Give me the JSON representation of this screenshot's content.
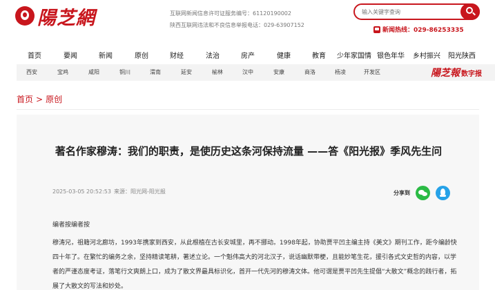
{
  "header": {
    "logo_text": "陽芝網",
    "license_line1": "互联网新闻信息许可证服务编号：61120190002",
    "license_line2": "陕西互联网违法和不良信息举报电话：029-63907152",
    "search_placeholder": "输入关键字查询",
    "hotline": "新闻热线：029-86253335"
  },
  "nav": {
    "items": [
      "首页",
      "要闻",
      "新闻",
      "原创",
      "财经",
      "法治",
      "房产",
      "健康",
      "教育",
      "少年家国情",
      "银色年华",
      "乡村振兴",
      "阳光陕西"
    ]
  },
  "subnav": {
    "items": [
      "西安",
      "宝鸡",
      "咸阳",
      "铜川",
      "渭南",
      "延安",
      "榆林",
      "汉中",
      "安康",
      "商洛",
      "杨凌",
      "开发区"
    ],
    "brand": "陽芝報",
    "brand_sub": "数字报"
  },
  "breadcrumb": {
    "home": "首页",
    "separator": ">",
    "current": "原创"
  },
  "article": {
    "title": "著名作家穆涛：我们的职责，是使历史这条河保持流量 ——答《阳光报》季风先生问",
    "date": "2025-03-05 20:52:53",
    "source_label": "来源：",
    "source": "阳光网-阳光报",
    "share_label": "分享到",
    "editor_note": "编者按编者按",
    "body": "穆涛兄，祖籍河北廊坊，1993年携家到西安，从此根植在古长安城里，再不挪动。1998年起，协助贾平凹主编主持《美文》期刊工作，距今编龄快四十年了。在繁忙的编务之余，坚持精读笔耕，著述立论。一个魁伟高大的河北汉子，说话幽默带梗，且能妙笔生花，援引各式文史哲的内容，以学者的严谨态度考证，落笔行文爽朗上口，成为了散文界最具标识化，首开一代先河的穆涛文体。他可谓是贾平凹先生提倡“大散文”概念的践行者，拓展了大散文的写法和妙处。"
  }
}
